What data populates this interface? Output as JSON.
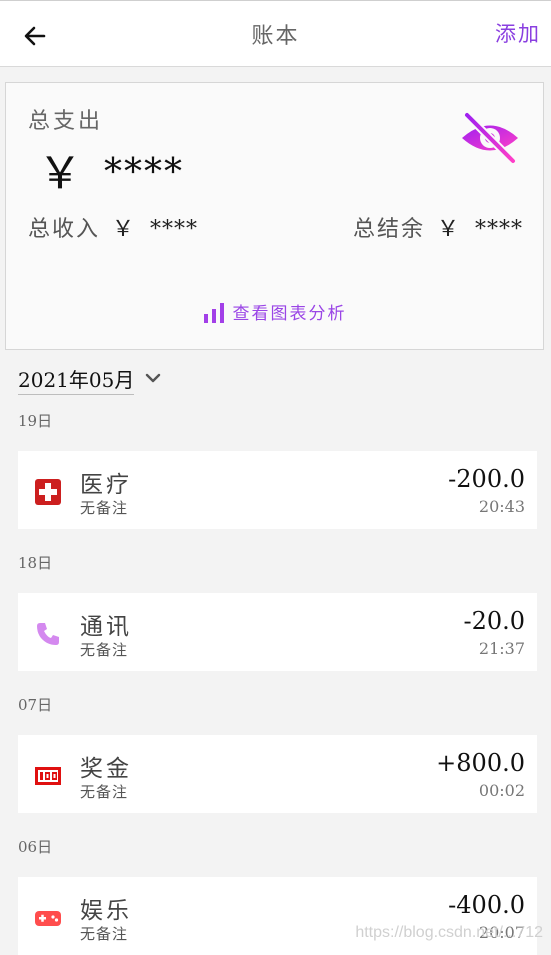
{
  "header": {
    "title": "账本",
    "add_label": "添加"
  },
  "summary": {
    "total_expense_label": "总支出",
    "currency_symbol": "￥",
    "total_expense_value": "****",
    "total_income_label": "总收入",
    "total_income_value": "****",
    "balance_label": "总结余",
    "balance_value": "****",
    "chart_link_label": "查看图表分析"
  },
  "month_selector": {
    "value": "2021年05月"
  },
  "groups": [
    {
      "day": "19日",
      "record": {
        "category": "医疗",
        "note": "无备注",
        "amount": "-200.0",
        "time": "20:43",
        "icon": "medical-cross-icon"
      }
    },
    {
      "day": "18日",
      "record": {
        "category": "通讯",
        "note": "无备注",
        "amount": "-20.0",
        "time": "21:37",
        "icon": "phone-icon"
      }
    },
    {
      "day": "07日",
      "record": {
        "category": "奖金",
        "note": "无备注",
        "amount": "+800.0",
        "time": "00:02",
        "icon": "bonus-100-icon"
      }
    },
    {
      "day": "06日",
      "record": {
        "category": "娱乐",
        "note": "无备注",
        "amount": "-400.0",
        "time": "20:07",
        "icon": "gamepad-icon"
      }
    }
  ],
  "watermark": "https://blog.csdn.net/...712",
  "colors": {
    "accent": "#8a3fe0",
    "eye_gradient_start": "#a020f0",
    "eye_gradient_end": "#ff3fc8",
    "medical_red": "#cc1f1f",
    "phone_purple": "#d489ef",
    "bonus_red": "#e01010",
    "game_red": "#ff4d4d"
  }
}
